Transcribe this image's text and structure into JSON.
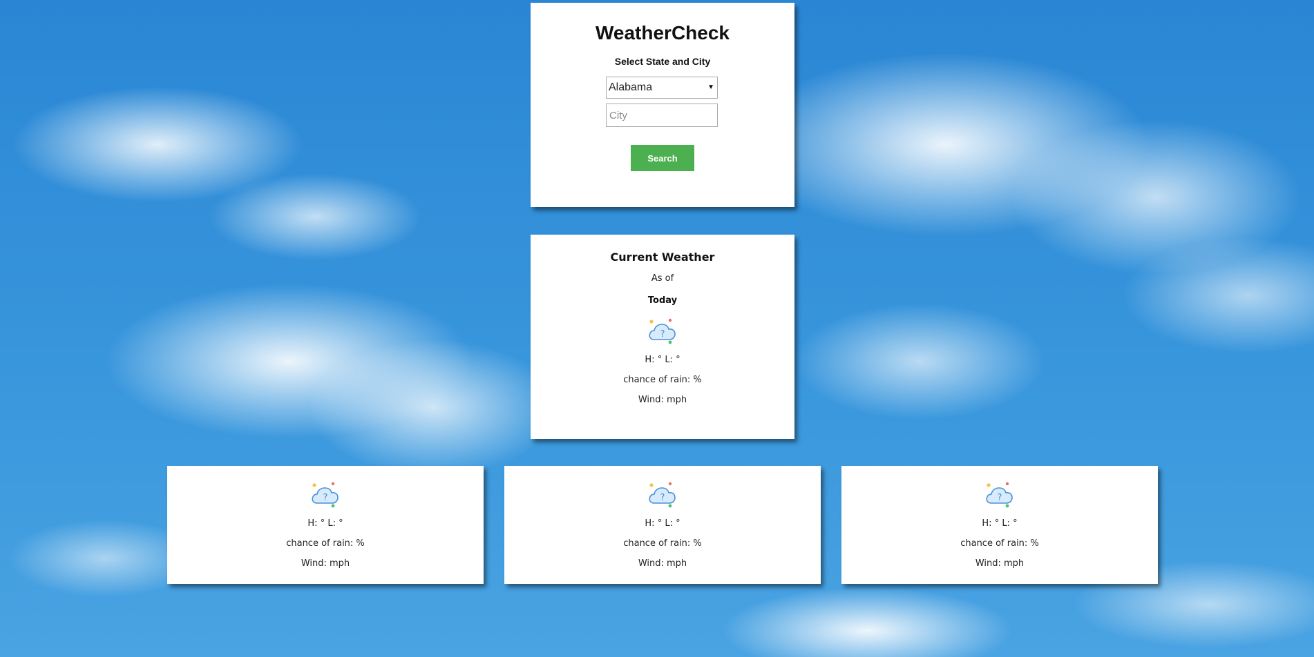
{
  "app": {
    "title": "WeatherCheck",
    "subtitle": "Select State and City"
  },
  "search": {
    "state_selected": "Alabama",
    "state_arrow": "▼",
    "city_placeholder": "City",
    "city_value": "",
    "button_label": "Search",
    "button_color": "#4caf50"
  },
  "current": {
    "title": "Current Weather",
    "as_of": "As of",
    "day": "Today",
    "icon": "unknown-weather-cloud-icon",
    "temp": "H: ° L: °",
    "rain": "chance of rain: %",
    "wind": "Wind: mph"
  },
  "forecast": [
    {
      "icon": "unknown-weather-cloud-icon",
      "temp": "H: ° L: °",
      "rain": "chance of rain: %",
      "wind": "Wind: mph"
    },
    {
      "icon": "unknown-weather-cloud-icon",
      "temp": "H: ° L: °",
      "rain": "chance of rain: %",
      "wind": "Wind: mph"
    },
    {
      "icon": "unknown-weather-cloud-icon",
      "temp": "H: ° L: °",
      "rain": "chance of rain: %",
      "wind": "Wind: mph"
    }
  ]
}
